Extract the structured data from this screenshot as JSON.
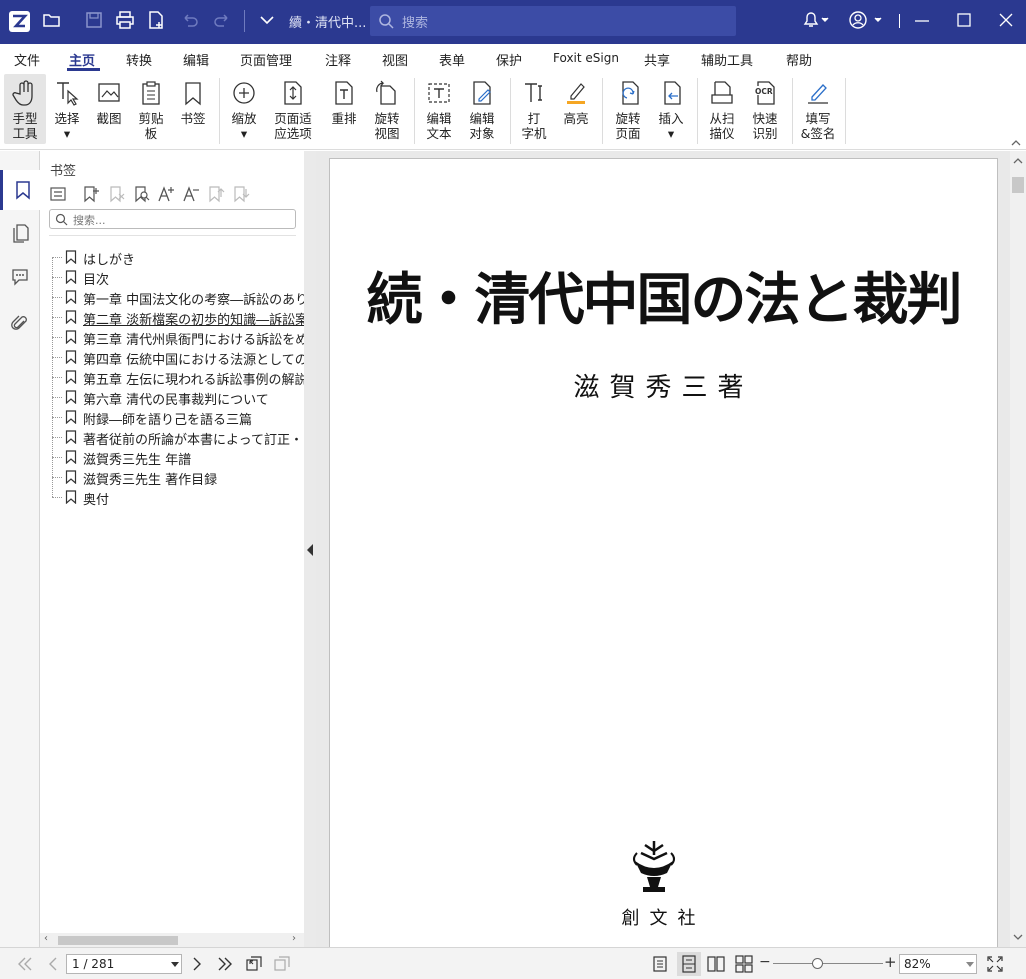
{
  "titlebar": {
    "document_title": "續・清代中...",
    "search_placeholder": "搜索"
  },
  "menu": {
    "items": [
      "文件",
      "主页",
      "转换",
      "编辑",
      "页面管理",
      "注释",
      "视图",
      "表单",
      "保护",
      "Foxit eSign",
      "共享",
      "辅助工具",
      "帮助"
    ],
    "active": "主页"
  },
  "ribbon": {
    "hand_tool": "手型\n工具",
    "select": "选择",
    "screenshot": "截图",
    "clipboard": "剪贴\n板",
    "bookmark": "书签",
    "zoom": "缩放",
    "fit_page": "页面适\n应选项",
    "reflow": "重排",
    "rotate_view": "旋转\n视图",
    "edit_text": "编辑\n文本",
    "edit_object": "编辑\n对象",
    "typewriter": "打\n字机",
    "highlight": "高亮",
    "rotate_page": "旋转\n页面",
    "insert": "插入",
    "from_scanner": "从扫\n描仪",
    "quick_ocr": "快速\n识别",
    "fill_sign": "填写\n&签名"
  },
  "panel": {
    "title": "书签",
    "search_placeholder": "搜索...",
    "bookmarks": [
      "はしがき",
      "目次",
      "第一章 中国法文化の考察―訴訟のあり",
      "第二章 淡新檔案の初歩的知識―訴訟案",
      "第三章 清代州県衙門における訴訟をめ",
      "第四章 伝統中国における法源としての",
      "第五章 左伝に現われる訴訟事例の解説",
      "第六章 清代の民事裁判について",
      "附録―師を語り己を語る三篇",
      "著者従前の所論が本書によって訂正・",
      "滋賀秀三先生 年譜",
      "滋賀秀三先生 著作目録",
      "奥付"
    ],
    "selected_index": 3
  },
  "document": {
    "title": "続・清代中国の法と裁判",
    "author": "滋賀秀三著",
    "publisher": "創文社"
  },
  "statusbar": {
    "page_indicator": "1 / 281",
    "zoom": "82%"
  },
  "colors": {
    "titlebar": "#2b3990",
    "accent": "#2b3990",
    "highlight_marker": "#f5a623"
  }
}
